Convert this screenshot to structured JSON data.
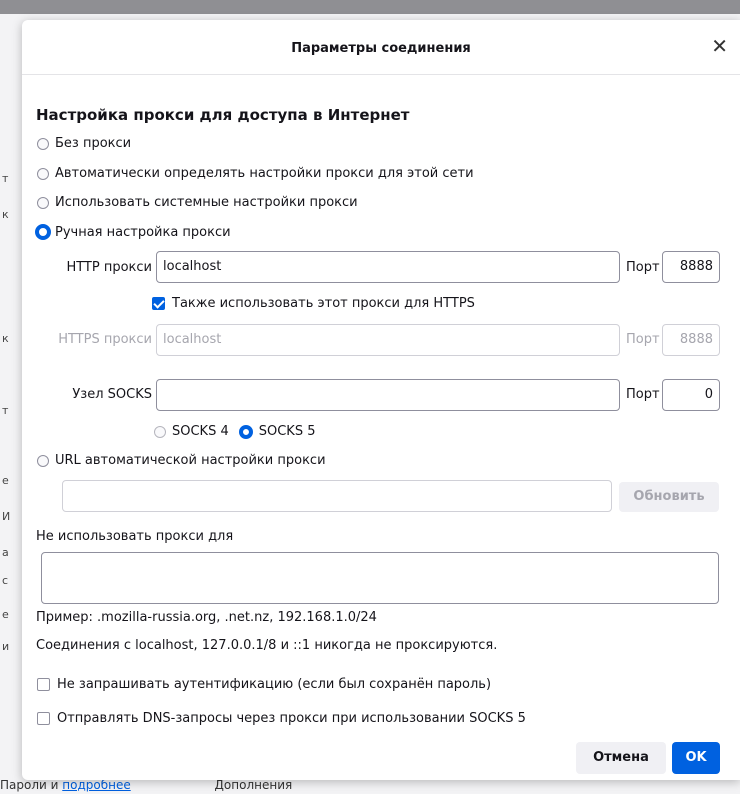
{
  "background": {
    "fragments": [
      "т",
      "к",
      "к",
      "т",
      "е",
      "И",
      "а",
      "с",
      "е",
      "и"
    ],
    "footer_text": "Пароли и",
    "footer_link": "подробнее",
    "footer_right": "Дополнения"
  },
  "dialog": {
    "title": "Параметры соединения",
    "close_glyph": "✕"
  },
  "section_title": "Настройка прокси для доступа в Интернет",
  "proxy_options": {
    "none": "Без прокси",
    "auto_detect": "Автоматически определять настройки прокси для этой сети",
    "system": "Использовать системные настройки прокси",
    "manual": "Ручная настройка прокси",
    "pac": "URL автоматической настройки прокси"
  },
  "http_proxy": {
    "label": "HTTP прокси",
    "value": "localhost",
    "port_label": "Порт",
    "port_value": "8888"
  },
  "also_https_label": "Также использовать этот прокси для HTTPS",
  "https_proxy": {
    "label": "HTTPS прокси",
    "value": "localhost",
    "port_label": "Порт",
    "port_value": "8888"
  },
  "socks": {
    "label": "Узел SOCKS",
    "value": "",
    "port_label": "Порт",
    "port_value": "0",
    "v4": "SOCKS 4",
    "v5": "SOCKS 5"
  },
  "pac": {
    "url_value": "",
    "refresh_label": "Обновить"
  },
  "no_proxy": {
    "label": "Не использовать прокси для",
    "value": "",
    "example": "Пример: .mozilla-russia.org, .net.nz, 192.168.1.0/24",
    "note": "Соединения с localhost, 127.0.0.1/8 и ::1 никогда не проксируются."
  },
  "no_auth_prompt_label": "Не запрашивать аутентификацию (если был сохранён пароль)",
  "dns_over_socks_label": "Отправлять DNS-запросы через прокси при использовании SOCKS 5",
  "buttons": {
    "cancel": "Отмена",
    "ok": "OK"
  },
  "colors": {
    "accent": "#0061e0",
    "overlay": "#8f8f93"
  }
}
